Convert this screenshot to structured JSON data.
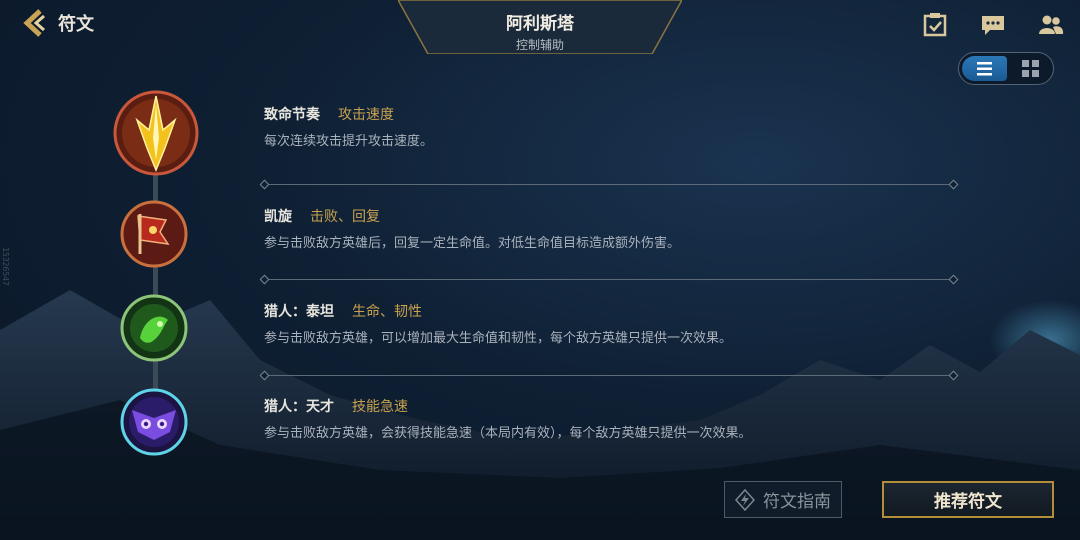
{
  "header": {
    "back_label": "符文",
    "champion_name": "阿利斯塔",
    "champion_role": "控制辅助"
  },
  "side_id": "15326547",
  "runes": [
    {
      "name": "致命节奏",
      "tag": "攻击速度",
      "description": "每次连续攻击提升攻击速度。",
      "icon": "lethal-tempo-icon"
    },
    {
      "name": "凯旋",
      "tag": "击败、回复",
      "description": "参与击败敌方英雄后，回复一定生命值。对低生命值目标造成额外伤害。",
      "icon": "triumph-icon"
    },
    {
      "name": "猎人：泰坦",
      "tag": "生命、韧性",
      "description": "参与击败敌方英雄，可以增加最大生命值和韧性，每个敌方英雄只提供一次效果。",
      "icon": "hunter-titan-icon"
    },
    {
      "name": "猎人：天才",
      "tag": "技能急速",
      "description": "参与击败敌方英雄，会获得技能急速（本局内有效），每个敌方英雄只提供一次效果。",
      "icon": "hunter-genius-icon"
    }
  ],
  "buttons": {
    "guide": "符文指南",
    "recommend": "推荐符文"
  },
  "colors": {
    "accent_gold": "#c8a24e",
    "toggle_active": "#2b78b8"
  }
}
